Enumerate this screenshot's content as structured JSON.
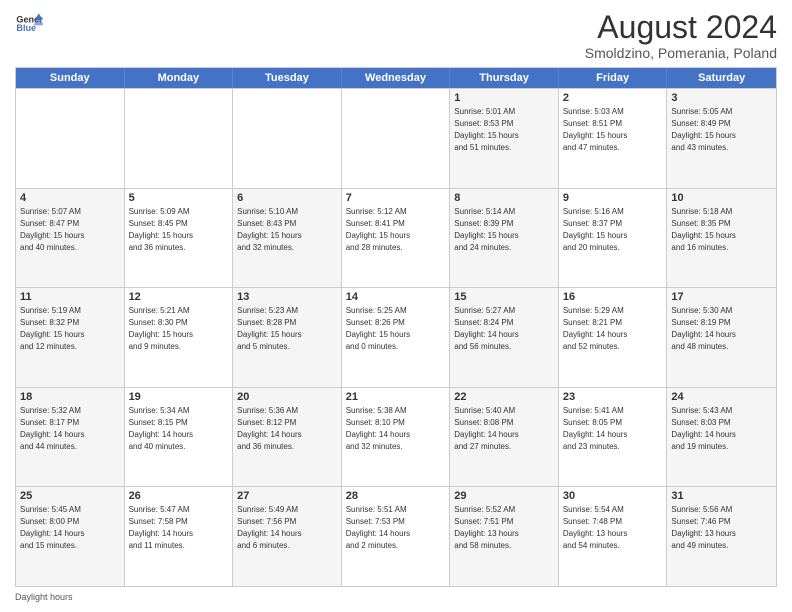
{
  "logo": {
    "line1": "General",
    "line2": "Blue"
  },
  "title": "August 2024",
  "subtitle": "Smoldzino, Pomerania, Poland",
  "weekdays": [
    "Sunday",
    "Monday",
    "Tuesday",
    "Wednesday",
    "Thursday",
    "Friday",
    "Saturday"
  ],
  "rows": [
    [
      {
        "day": "",
        "info": ""
      },
      {
        "day": "",
        "info": ""
      },
      {
        "day": "",
        "info": ""
      },
      {
        "day": "",
        "info": ""
      },
      {
        "day": "1",
        "info": "Sunrise: 5:01 AM\nSunset: 8:53 PM\nDaylight: 15 hours\nand 51 minutes."
      },
      {
        "day": "2",
        "info": "Sunrise: 5:03 AM\nSunset: 8:51 PM\nDaylight: 15 hours\nand 47 minutes."
      },
      {
        "day": "3",
        "info": "Sunrise: 5:05 AM\nSunset: 8:49 PM\nDaylight: 15 hours\nand 43 minutes."
      }
    ],
    [
      {
        "day": "4",
        "info": "Sunrise: 5:07 AM\nSunset: 8:47 PM\nDaylight: 15 hours\nand 40 minutes."
      },
      {
        "day": "5",
        "info": "Sunrise: 5:09 AM\nSunset: 8:45 PM\nDaylight: 15 hours\nand 36 minutes."
      },
      {
        "day": "6",
        "info": "Sunrise: 5:10 AM\nSunset: 8:43 PM\nDaylight: 15 hours\nand 32 minutes."
      },
      {
        "day": "7",
        "info": "Sunrise: 5:12 AM\nSunset: 8:41 PM\nDaylight: 15 hours\nand 28 minutes."
      },
      {
        "day": "8",
        "info": "Sunrise: 5:14 AM\nSunset: 8:39 PM\nDaylight: 15 hours\nand 24 minutes."
      },
      {
        "day": "9",
        "info": "Sunrise: 5:16 AM\nSunset: 8:37 PM\nDaylight: 15 hours\nand 20 minutes."
      },
      {
        "day": "10",
        "info": "Sunrise: 5:18 AM\nSunset: 8:35 PM\nDaylight: 15 hours\nand 16 minutes."
      }
    ],
    [
      {
        "day": "11",
        "info": "Sunrise: 5:19 AM\nSunset: 8:32 PM\nDaylight: 15 hours\nand 12 minutes."
      },
      {
        "day": "12",
        "info": "Sunrise: 5:21 AM\nSunset: 8:30 PM\nDaylight: 15 hours\nand 9 minutes."
      },
      {
        "day": "13",
        "info": "Sunrise: 5:23 AM\nSunset: 8:28 PM\nDaylight: 15 hours\nand 5 minutes."
      },
      {
        "day": "14",
        "info": "Sunrise: 5:25 AM\nSunset: 8:26 PM\nDaylight: 15 hours\nand 0 minutes."
      },
      {
        "day": "15",
        "info": "Sunrise: 5:27 AM\nSunset: 8:24 PM\nDaylight: 14 hours\nand 56 minutes."
      },
      {
        "day": "16",
        "info": "Sunrise: 5:29 AM\nSunset: 8:21 PM\nDaylight: 14 hours\nand 52 minutes."
      },
      {
        "day": "17",
        "info": "Sunrise: 5:30 AM\nSunset: 8:19 PM\nDaylight: 14 hours\nand 48 minutes."
      }
    ],
    [
      {
        "day": "18",
        "info": "Sunrise: 5:32 AM\nSunset: 8:17 PM\nDaylight: 14 hours\nand 44 minutes."
      },
      {
        "day": "19",
        "info": "Sunrise: 5:34 AM\nSunset: 8:15 PM\nDaylight: 14 hours\nand 40 minutes."
      },
      {
        "day": "20",
        "info": "Sunrise: 5:36 AM\nSunset: 8:12 PM\nDaylight: 14 hours\nand 36 minutes."
      },
      {
        "day": "21",
        "info": "Sunrise: 5:38 AM\nSunset: 8:10 PM\nDaylight: 14 hours\nand 32 minutes."
      },
      {
        "day": "22",
        "info": "Sunrise: 5:40 AM\nSunset: 8:08 PM\nDaylight: 14 hours\nand 27 minutes."
      },
      {
        "day": "23",
        "info": "Sunrise: 5:41 AM\nSunset: 8:05 PM\nDaylight: 14 hours\nand 23 minutes."
      },
      {
        "day": "24",
        "info": "Sunrise: 5:43 AM\nSunset: 8:03 PM\nDaylight: 14 hours\nand 19 minutes."
      }
    ],
    [
      {
        "day": "25",
        "info": "Sunrise: 5:45 AM\nSunset: 8:00 PM\nDaylight: 14 hours\nand 15 minutes."
      },
      {
        "day": "26",
        "info": "Sunrise: 5:47 AM\nSunset: 7:58 PM\nDaylight: 14 hours\nand 11 minutes."
      },
      {
        "day": "27",
        "info": "Sunrise: 5:49 AM\nSunset: 7:56 PM\nDaylight: 14 hours\nand 6 minutes."
      },
      {
        "day": "28",
        "info": "Sunrise: 5:51 AM\nSunset: 7:53 PM\nDaylight: 14 hours\nand 2 minutes."
      },
      {
        "day": "29",
        "info": "Sunrise: 5:52 AM\nSunset: 7:51 PM\nDaylight: 13 hours\nand 58 minutes."
      },
      {
        "day": "30",
        "info": "Sunrise: 5:54 AM\nSunset: 7:48 PM\nDaylight: 13 hours\nand 54 minutes."
      },
      {
        "day": "31",
        "info": "Sunrise: 5:56 AM\nSunset: 7:46 PM\nDaylight: 13 hours\nand 49 minutes."
      }
    ]
  ],
  "footer": "Daylight hours"
}
